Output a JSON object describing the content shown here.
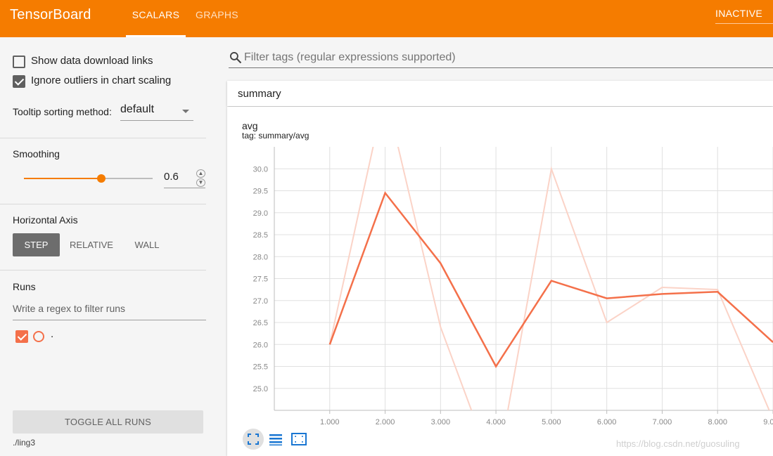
{
  "header": {
    "title": "TensorBoard",
    "tabs": [
      {
        "label": "SCALARS",
        "active": true
      },
      {
        "label": "GRAPHS",
        "active": false
      }
    ],
    "status": "INACTIVE",
    "accent_color": "#f57c00"
  },
  "sidebar": {
    "show_download_links": {
      "label": "Show data download links",
      "checked": false
    },
    "ignore_outliers": {
      "label": "Ignore outliers in chart scaling",
      "checked": true
    },
    "tooltip_sorting": {
      "label": "Tooltip sorting method:",
      "value": "default"
    },
    "smoothing": {
      "label": "Smoothing",
      "value": "0.6",
      "fraction": 0.6
    },
    "horizontal_axis": {
      "label": "Horizontal Axis",
      "options": [
        "STEP",
        "RELATIVE",
        "WALL"
      ],
      "selected": "STEP"
    },
    "runs": {
      "label": "Runs",
      "filter_placeholder": "Write a regex to filter runs",
      "items": [
        {
          "name": ".",
          "checked": true,
          "color": "#f4704a"
        }
      ]
    },
    "toggle_all_runs": "TOGGLE ALL RUNS",
    "logdir": "./ling3"
  },
  "main": {
    "filter_placeholder": "Filter tags (regular expressions supported)",
    "category": "summary",
    "watermark": "https://blog.csdn.net/guosuling"
  },
  "chart_data": {
    "type": "line",
    "title": "avg",
    "subtitle": "tag: summary/avg",
    "xlabel": "",
    "ylabel": "",
    "x_ticks": [
      "1.000",
      "2.000",
      "3.000",
      "4.000",
      "5.000",
      "6.000",
      "7.000",
      "8.000",
      "9.000"
    ],
    "y_ticks": [
      "25.0",
      "25.5",
      "26.0",
      "26.5",
      "27.0",
      "27.5",
      "28.0",
      "28.5",
      "29.0",
      "29.5",
      "30.0"
    ],
    "xlim": [
      0,
      9
    ],
    "ylim": [
      24.5,
      30.5
    ],
    "grid": true,
    "series": [
      {
        "role": "smoothed",
        "color": "#f4704a",
        "x": [
          1,
          2,
          3,
          4,
          5,
          6,
          7,
          8,
          9
        ],
        "y": [
          26.0,
          29.45,
          27.85,
          25.5,
          27.45,
          27.05,
          27.15,
          27.2,
          26.05
        ]
      },
      {
        "role": "raw",
        "color": "#fbd3c7",
        "x": [
          1,
          2,
          3,
          4,
          5,
          6,
          7,
          8,
          9
        ],
        "y": [
          26.0,
          31.75,
          26.4,
          23.0,
          30.0,
          26.5,
          27.3,
          27.25,
          24.3
        ]
      }
    ]
  },
  "chart_controls": [
    "fit-domain-icon",
    "log-scale-icon",
    "data-selection-icon"
  ]
}
